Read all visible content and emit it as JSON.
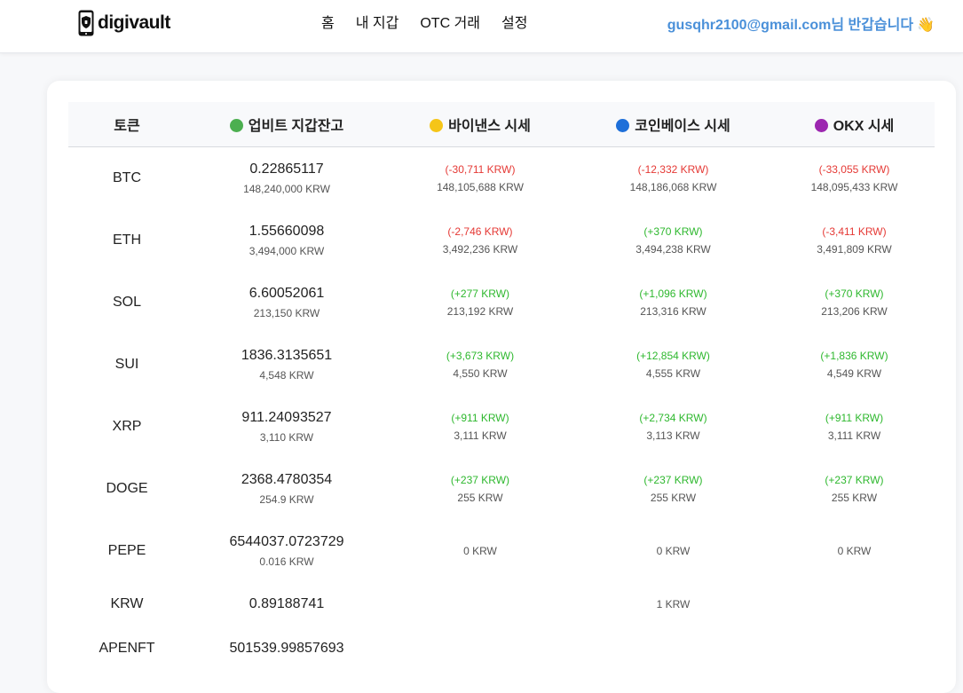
{
  "header": {
    "logo_text": "digivault",
    "nav": [
      "홈",
      "내 지갑",
      "OTC 거래",
      "설정"
    ],
    "greeting_email": "gusqhr2100@gmail.com",
    "greeting_suffix": "님 반갑습니다",
    "greeting_emoji": "👋"
  },
  "table": {
    "columns": [
      {
        "label": "토큰",
        "dot": ""
      },
      {
        "label": "업비트 지갑잔고",
        "dot": "#4caf50"
      },
      {
        "label": "바이낸스 시세",
        "dot": "#f5c518"
      },
      {
        "label": "코인베이스 시세",
        "dot": "#1e6fd9"
      },
      {
        "label": "OKX 시세",
        "dot": "#9c27b0"
      }
    ],
    "rows": [
      {
        "token": "BTC",
        "amount": "0.22865117",
        "krw": "148,240,000 KRW",
        "binance": {
          "diff": "(-30,711 KRW)",
          "sign": "neg",
          "price": "148,105,688 KRW"
        },
        "coinbase": {
          "diff": "(-12,332 KRW)",
          "sign": "neg",
          "price": "148,186,068 KRW"
        },
        "okx": {
          "diff": "(-33,055 KRW)",
          "sign": "neg",
          "price": "148,095,433 KRW"
        }
      },
      {
        "token": "ETH",
        "amount": "1.55660098",
        "krw": "3,494,000 KRW",
        "binance": {
          "diff": "(-2,746 KRW)",
          "sign": "neg",
          "price": "3,492,236 KRW"
        },
        "coinbase": {
          "diff": "(+370 KRW)",
          "sign": "pos",
          "price": "3,494,238 KRW"
        },
        "okx": {
          "diff": "(-3,411 KRW)",
          "sign": "neg",
          "price": "3,491,809 KRW"
        }
      },
      {
        "token": "SOL",
        "amount": "6.60052061",
        "krw": "213,150 KRW",
        "binance": {
          "diff": "(+277 KRW)",
          "sign": "pos",
          "price": "213,192 KRW"
        },
        "coinbase": {
          "diff": "(+1,096 KRW)",
          "sign": "pos",
          "price": "213,316 KRW"
        },
        "okx": {
          "diff": "(+370 KRW)",
          "sign": "pos",
          "price": "213,206 KRW"
        }
      },
      {
        "token": "SUI",
        "amount": "1836.3135651",
        "krw": "4,548 KRW",
        "binance": {
          "diff": "(+3,673 KRW)",
          "sign": "pos",
          "price": "4,550 KRW"
        },
        "coinbase": {
          "diff": "(+12,854 KRW)",
          "sign": "pos",
          "price": "4,555 KRW"
        },
        "okx": {
          "diff": "(+1,836 KRW)",
          "sign": "pos",
          "price": "4,549 KRW"
        }
      },
      {
        "token": "XRP",
        "amount": "911.24093527",
        "krw": "3,110 KRW",
        "binance": {
          "diff": "(+911 KRW)",
          "sign": "pos",
          "price": "3,111 KRW"
        },
        "coinbase": {
          "diff": "(+2,734 KRW)",
          "sign": "pos",
          "price": "3,113 KRW"
        },
        "okx": {
          "diff": "(+911 KRW)",
          "sign": "pos",
          "price": "3,111 KRW"
        }
      },
      {
        "token": "DOGE",
        "amount": "2368.4780354",
        "krw": "254.9 KRW",
        "binance": {
          "diff": "(+237 KRW)",
          "sign": "pos",
          "price": "255 KRW"
        },
        "coinbase": {
          "diff": "(+237 KRW)",
          "sign": "pos",
          "price": "255 KRW"
        },
        "okx": {
          "diff": "(+237 KRW)",
          "sign": "pos",
          "price": "255 KRW"
        }
      },
      {
        "token": "PEPE",
        "amount": "6544037.0723729",
        "krw": "0.016 KRW",
        "binance": {
          "diff": "",
          "sign": "",
          "price": "0 KRW"
        },
        "coinbase": {
          "diff": "",
          "sign": "",
          "price": "0 KRW"
        },
        "okx": {
          "diff": "",
          "sign": "",
          "price": "0 KRW"
        }
      },
      {
        "token": "KRW",
        "amount": "0.89188741",
        "krw": "",
        "binance": {
          "diff": "",
          "sign": "",
          "price": ""
        },
        "coinbase": {
          "diff": "",
          "sign": "",
          "price": "1 KRW"
        },
        "okx": {
          "diff": "",
          "sign": "",
          "price": ""
        }
      },
      {
        "token": "APENFT",
        "amount": "501539.99857693",
        "krw": "",
        "binance": {
          "diff": "",
          "sign": "",
          "price": ""
        },
        "coinbase": {
          "diff": "",
          "sign": "",
          "price": ""
        },
        "okx": {
          "diff": "",
          "sign": "",
          "price": ""
        }
      }
    ]
  },
  "colors": {
    "negative": "#e53935",
    "positive": "#2eb82e",
    "greeting": "#4a90d9"
  }
}
